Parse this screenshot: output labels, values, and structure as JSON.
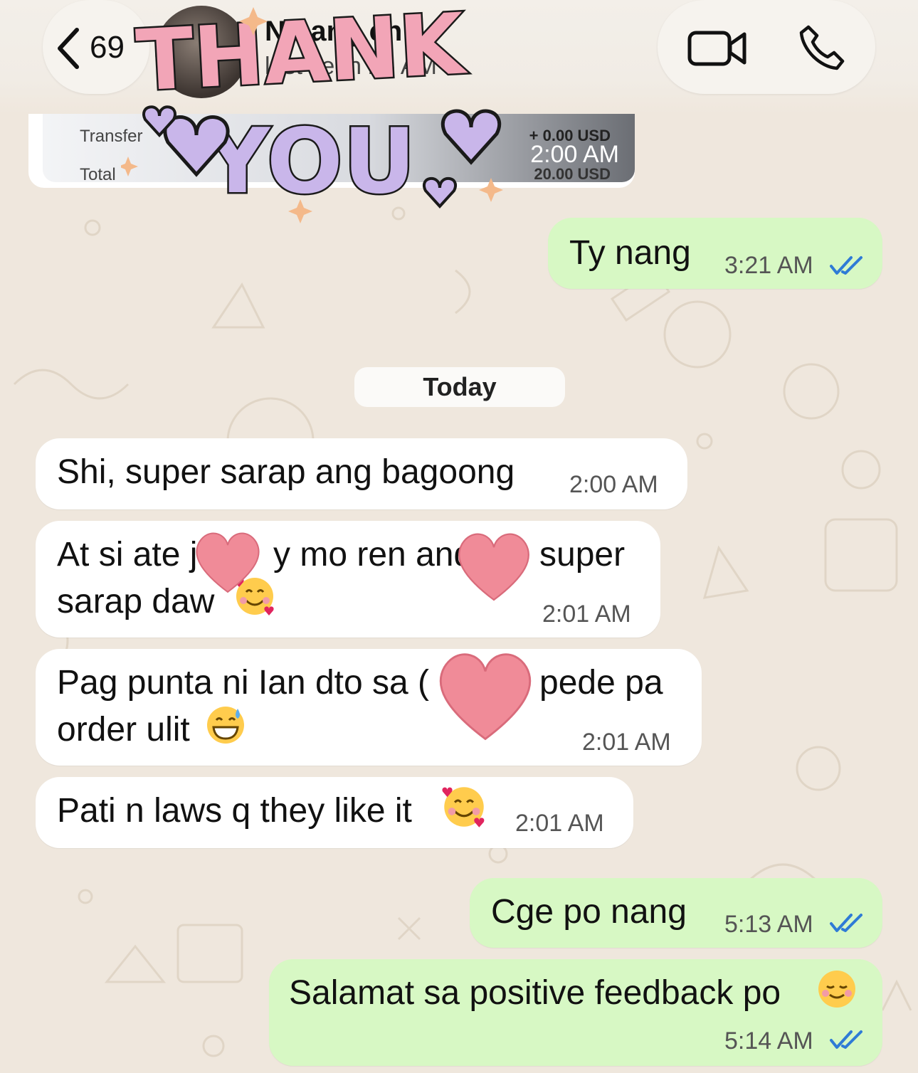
{
  "header": {
    "back_count": "69",
    "contact_name": "Ninang ch",
    "contact_status": "last seen 25 AM"
  },
  "receipt": {
    "transfer_label": "Transfer",
    "transfer_amount": "+ 0.00 USD",
    "total_label": "Total",
    "total_amount": "20.00 USD",
    "time": "2:00 AM"
  },
  "sticker_text": "THANK YOU",
  "messages_top": [
    {
      "text": "Ty nang",
      "time": "3:21 AM"
    }
  ],
  "date_separator": "Today",
  "messages": [
    {
      "line1": "Shi, super sarap ang bagoong",
      "time": "2:00 AM"
    },
    {
      "line1": "At si ate j",
      "line1b": "y mo ren and",
      "line1c": "super",
      "line2": "sarap daw",
      "time": "2:01 AM"
    },
    {
      "line1": "Pag punta ni Ian dto sa (",
      "line1c": "pede pa",
      "line2": "order ulit",
      "time": "2:01 AM"
    },
    {
      "line1": "Pati n laws q they like it",
      "time": "2:01 AM"
    }
  ],
  "replies": [
    {
      "text": "Cge po nang",
      "time": "5:13 AM"
    },
    {
      "text": "Salamat sa positive feedback po",
      "time": "5:14 AM"
    }
  ],
  "colors": {
    "incoming_bubble": "#ffffff",
    "outgoing_bubble": "#d7f8c4",
    "read_ticks": "#2f7bd6",
    "wallpaper": "#efe7dd",
    "heart_sticker": "#f08b98",
    "sticker_pink": "#f4a7b8",
    "sticker_lilac": "#c9b6ea"
  }
}
